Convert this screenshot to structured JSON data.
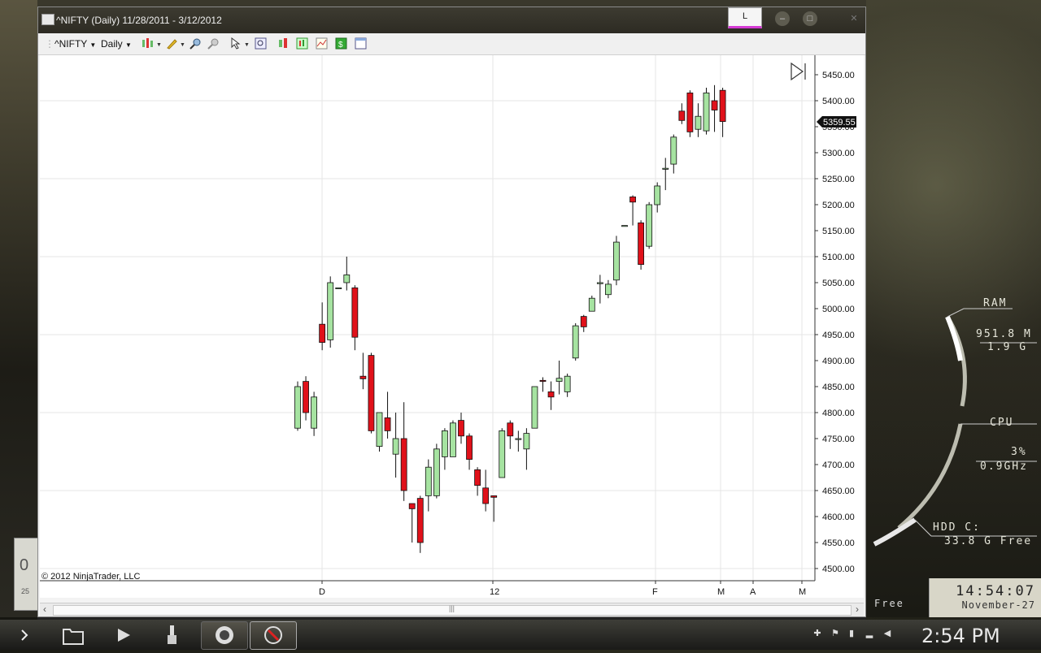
{
  "window": {
    "title": "^NIFTY (Daily)  11/28/2011 - 3/12/2012",
    "tab_label": "L",
    "min_icon": "minimize-icon",
    "max_icon": "maximize-icon",
    "close_icon": "close-icon"
  },
  "toolbar": {
    "instrument": "^NIFTY",
    "interval": "Daily"
  },
  "chart": {
    "copyright": "© 2012 NinjaTrader, LLC",
    "last_price": "5359.55",
    "y_ticks": [
      "5450.00",
      "5400.00",
      "5350.00",
      "5300.00",
      "5250.00",
      "5200.00",
      "5150.00",
      "5100.00",
      "5050.00",
      "5000.00",
      "4950.00",
      "4900.00",
      "4850.00",
      "4800.00",
      "4750.00",
      "4700.00",
      "4650.00",
      "4600.00",
      "4550.00",
      "4500.00"
    ],
    "x_ticks": [
      "D",
      "12",
      "F",
      "M",
      "A",
      "M"
    ]
  },
  "chart_data": {
    "type": "candlestick",
    "title": "^NIFTY (Daily)",
    "ylim": [
      4490,
      5475
    ],
    "candles": [
      {
        "o": 4770,
        "h": 4860,
        "l": 4765,
        "c": 4850
      },
      {
        "o": 4860,
        "h": 4870,
        "l": 4785,
        "c": 4800
      },
      {
        "o": 4770,
        "h": 4840,
        "l": 4755,
        "c": 4830
      },
      {
        "o": 4970,
        "h": 5012,
        "l": 4920,
        "c": 4935
      },
      {
        "o": 4940,
        "h": 5062,
        "l": 4925,
        "c": 5050
      },
      {
        "o": 5040,
        "h": 5040,
        "l": 5040,
        "c": 5040
      },
      {
        "o": 5050,
        "h": 5100,
        "l": 5035,
        "c": 5065
      },
      {
        "o": 5040,
        "h": 5045,
        "l": 4920,
        "c": 4945
      },
      {
        "o": 4870,
        "h": 4915,
        "l": 4845,
        "c": 4865
      },
      {
        "o": 4910,
        "h": 4915,
        "l": 4760,
        "c": 4765
      },
      {
        "o": 4735,
        "h": 4800,
        "l": 4725,
        "c": 4800
      },
      {
        "o": 4790,
        "h": 4840,
        "l": 4750,
        "c": 4765
      },
      {
        "o": 4720,
        "h": 4800,
        "l": 4675,
        "c": 4750
      },
      {
        "o": 4750,
        "h": 4820,
        "l": 4630,
        "c": 4650
      },
      {
        "o": 4625,
        "h": 4625,
        "l": 4550,
        "c": 4615
      },
      {
        "o": 4635,
        "h": 4640,
        "l": 4530,
        "c": 4550
      },
      {
        "o": 4640,
        "h": 4710,
        "l": 4610,
        "c": 4695
      },
      {
        "o": 4640,
        "h": 4740,
        "l": 4635,
        "c": 4730
      },
      {
        "o": 4715,
        "h": 4770,
        "l": 4690,
        "c": 4765
      },
      {
        "o": 4715,
        "h": 4785,
        "l": 4715,
        "c": 4780
      },
      {
        "o": 4785,
        "h": 4800,
        "l": 4740,
        "c": 4755
      },
      {
        "o": 4755,
        "h": 4760,
        "l": 4690,
        "c": 4710
      },
      {
        "o": 4690,
        "h": 4695,
        "l": 4640,
        "c": 4660
      },
      {
        "o": 4655,
        "h": 4690,
        "l": 4610,
        "c": 4625
      },
      {
        "o": 4640,
        "h": 4640,
        "l": 4590,
        "c": 4637
      },
      {
        "o": 4675,
        "h": 4770,
        "l": 4675,
        "c": 4765
      },
      {
        "o": 4780,
        "h": 4785,
        "l": 4730,
        "c": 4755
      },
      {
        "o": 4750,
        "h": 4765,
        "l": 4725,
        "c": 4750
      },
      {
        "o": 4730,
        "h": 4770,
        "l": 4690,
        "c": 4760
      },
      {
        "o": 4770,
        "h": 4850,
        "l": 4770,
        "c": 4850
      },
      {
        "o": 4862,
        "h": 4868,
        "l": 4840,
        "c": 4860
      },
      {
        "o": 4840,
        "h": 4860,
        "l": 4805,
        "c": 4830
      },
      {
        "o": 4860,
        "h": 4900,
        "l": 4835,
        "c": 4866
      },
      {
        "o": 4840,
        "h": 4875,
        "l": 4830,
        "c": 4870
      },
      {
        "o": 4905,
        "h": 4972,
        "l": 4900,
        "c": 4967
      },
      {
        "o": 4985,
        "h": 4988,
        "l": 4955,
        "c": 4965
      },
      {
        "o": 4995,
        "h": 5025,
        "l": 4995,
        "c": 5020
      },
      {
        "o": 5048,
        "h": 5065,
        "l": 5010,
        "c": 5050
      },
      {
        "o": 5027,
        "h": 5055,
        "l": 5020,
        "c": 5047
      },
      {
        "o": 5055,
        "h": 5140,
        "l": 5045,
        "c": 5128
      },
      {
        "o": 5160,
        "h": 5160,
        "l": 5160,
        "c": 5160
      },
      {
        "o": 5215,
        "h": 5218,
        "l": 5160,
        "c": 5205
      },
      {
        "o": 5165,
        "h": 5170,
        "l": 5075,
        "c": 5085
      },
      {
        "o": 5120,
        "h": 5205,
        "l": 5115,
        "c": 5200
      },
      {
        "o": 5200,
        "h": 5243,
        "l": 5185,
        "c": 5236
      },
      {
        "o": 5270,
        "h": 5290,
        "l": 5228,
        "c": 5270
      },
      {
        "o": 5278,
        "h": 5335,
        "l": 5260,
        "c": 5330
      },
      {
        "o": 5380,
        "h": 5395,
        "l": 5355,
        "c": 5362
      },
      {
        "o": 5415,
        "h": 5420,
        "l": 5330,
        "c": 5340
      },
      {
        "o": 5345,
        "h": 5395,
        "l": 5330,
        "c": 5370
      },
      {
        "o": 5342,
        "h": 5425,
        "l": 5335,
        "c": 5415
      },
      {
        "o": 5400,
        "h": 5430,
        "l": 5340,
        "c": 5382
      },
      {
        "o": 5420,
        "h": 5425,
        "l": 5330,
        "c": 5360
      }
    ]
  },
  "widgets": {
    "ram_label": "RAM",
    "ram_used": "951.8 M",
    "ram_total": "1.9 G",
    "cpu_label": "CPU",
    "cpu_pct": "3%",
    "cpu_freq": "0.9GHz",
    "hdd_label": "HDD C:",
    "hdd_free": "33.8 G Free",
    "free_label": "Free",
    "clock_time": "14:54:07",
    "clock_date": "November-27",
    "stub_num": "0",
    "stub_small": "25"
  },
  "taskbar": {
    "time": "2:54 PM"
  },
  "colors": {
    "up": "#a6e3a1",
    "down": "#e0111a",
    "grid": "#e6e6e6",
    "axis": "#333333"
  }
}
